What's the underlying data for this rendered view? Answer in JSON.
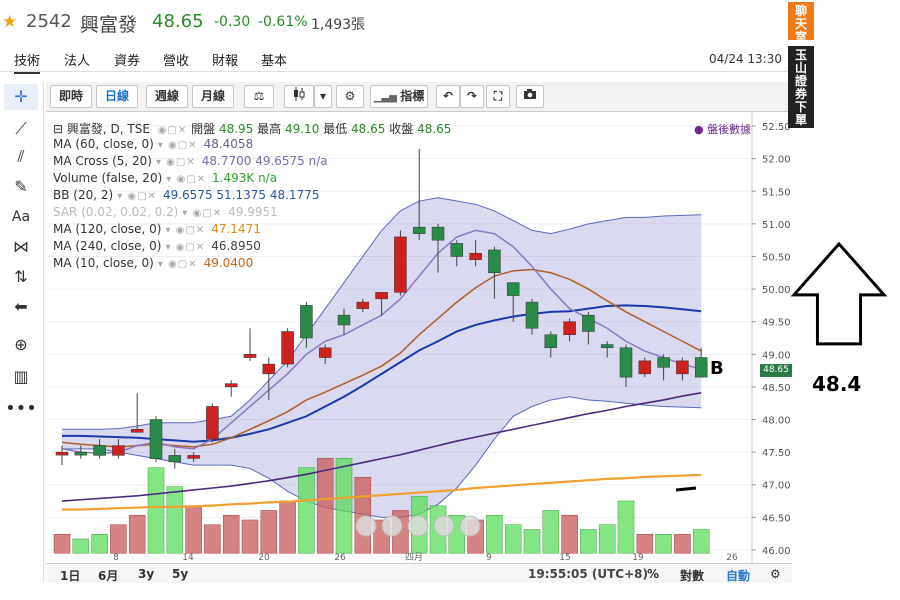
{
  "stock": {
    "code": "2542",
    "name": "興富發",
    "price": "48.65",
    "change": "-0.30",
    "change_pct": "-0.61%",
    "volume": "1,493張"
  },
  "tabs": [
    "技術",
    "法人",
    "資券",
    "營收",
    "財報",
    "基本"
  ],
  "datetime": "04/24 13:30",
  "toolbar": {
    "buttons": [
      "即時",
      "日線",
      "週線",
      "月線",
      "⚖",
      "▾",
      "⚙",
      "指標",
      "↶",
      "↷",
      "⛶",
      "📷"
    ],
    "active": "日線",
    "indicators_label": "指標"
  },
  "legend": {
    "main": {
      "label": "興富發, D, TSE",
      "open_lbl": "開盤",
      "open": "48.95",
      "high_lbl": "最高",
      "high": "49.10",
      "low_lbl": "最低",
      "low": "48.65",
      "close_lbl": "收盤",
      "close": "48.65"
    },
    "after_hours": "● 盤後數據",
    "rows": [
      {
        "label": "MA (60, close, 0)",
        "values": "48.4058",
        "color": "#6b5b9a"
      },
      {
        "label": "MA Cross (5, 20)",
        "values": "48.7700  49.6575  n/a",
        "color": "#7a6bb0"
      },
      {
        "label": "Volume (false, 20)",
        "values": "1.493K  n/a",
        "color": "#2aa52a"
      },
      {
        "label": "BB (20, 2)",
        "values": "49.6575  51.1375  48.1775",
        "color": "#2a55b0"
      },
      {
        "label": "SAR (0.02, 0.02, 0.2)",
        "values": "49.9951",
        "color": "#bbbbbb"
      },
      {
        "label": "MA (120, close, 0)",
        "values": "47.1471",
        "color": "#e08a1a"
      },
      {
        "label": "MA (240, close, 0)",
        "values": "46.8950",
        "color": "#444444"
      },
      {
        "label": "MA (10, close, 0)",
        "values": "49.0400",
        "color": "#c06a1a"
      }
    ]
  },
  "yaxis": [
    "52.50",
    "52.00",
    "51.50",
    "51.00",
    "50.50",
    "50.00",
    "49.50",
    "49.00",
    "48.50",
    "48.00",
    "47.50",
    "47.00",
    "46.50",
    "46.00"
  ],
  "xaxis": [
    "8",
    "14",
    "20",
    "26",
    "四月",
    "9",
    "15",
    "19",
    "26"
  ],
  "price_badge": "48.65",
  "annotation_b": "B",
  "annotation_value": "48.4",
  "bottombar": {
    "ranges": [
      "1日",
      "6月",
      "3y",
      "5y"
    ],
    "time": "19:55:05 (UTC+8)",
    "pct": "%",
    "log": "對數",
    "auto": "自動"
  },
  "sidebar": {
    "chat": "聊天室",
    "broker": "玉山證券下單",
    "chat_color": "#f07a1a",
    "broker_color": "#222222"
  },
  "chart_data": {
    "type": "candlestick",
    "ylim": [
      45.8,
      52.7
    ],
    "candles": [
      {
        "o": 47.5,
        "c": 47.5,
        "h": 47.6,
        "l": 47.3,
        "up": true
      },
      {
        "o": 47.5,
        "c": 47.5,
        "h": 47.6,
        "l": 47.4,
        "up": false
      },
      {
        "o": 47.6,
        "c": 47.45,
        "h": 47.7,
        "l": 47.4,
        "up": false
      },
      {
        "o": 47.6,
        "c": 47.45,
        "h": 47.7,
        "l": 47.4,
        "up": true
      },
      {
        "o": 47.85,
        "c": 47.85,
        "h": 48.4,
        "l": 47.8,
        "up": true
      },
      {
        "o": 48.0,
        "c": 47.4,
        "h": 48.05,
        "l": 47.35,
        "up": false
      },
      {
        "o": 47.45,
        "c": 47.35,
        "h": 47.55,
        "l": 47.25,
        "up": false
      },
      {
        "o": 47.45,
        "c": 47.45,
        "h": 47.5,
        "l": 47.35,
        "up": true
      },
      {
        "o": 47.7,
        "c": 48.2,
        "h": 48.25,
        "l": 47.65,
        "up": true
      },
      {
        "o": 48.5,
        "c": 48.55,
        "h": 48.6,
        "l": 48.35,
        "up": true
      },
      {
        "o": 48.95,
        "c": 49.0,
        "h": 49.4,
        "l": 48.9,
        "up": true
      },
      {
        "o": 48.85,
        "c": 48.7,
        "h": 48.95,
        "l": 48.3,
        "up": true
      },
      {
        "o": 48.85,
        "c": 49.35,
        "h": 49.4,
        "l": 48.8,
        "up": true
      },
      {
        "o": 49.25,
        "c": 49.75,
        "h": 49.8,
        "l": 49.1,
        "up": false
      },
      {
        "o": 49.1,
        "c": 48.95,
        "h": 49.15,
        "l": 48.85,
        "up": true
      },
      {
        "o": 49.45,
        "c": 49.6,
        "h": 49.7,
        "l": 49.3,
        "up": false
      },
      {
        "o": 49.7,
        "c": 49.8,
        "h": 49.85,
        "l": 49.65,
        "up": true
      },
      {
        "o": 49.95,
        "c": 49.85,
        "h": 49.95,
        "l": 49.6,
        "up": true
      },
      {
        "o": 49.95,
        "c": 50.8,
        "h": 50.9,
        "l": 49.9,
        "up": true
      },
      {
        "o": 50.85,
        "c": 50.95,
        "h": 52.15,
        "l": 50.75,
        "up": false
      },
      {
        "o": 50.95,
        "c": 50.75,
        "h": 51.0,
        "l": 50.25,
        "up": false
      },
      {
        "o": 50.7,
        "c": 50.5,
        "h": 50.75,
        "l": 50.35,
        "up": false
      },
      {
        "o": 50.55,
        "c": 50.45,
        "h": 50.75,
        "l": 50.35,
        "up": true
      },
      {
        "o": 50.6,
        "c": 50.25,
        "h": 50.65,
        "l": 49.85,
        "up": false
      },
      {
        "o": 50.1,
        "c": 49.9,
        "h": 50.1,
        "l": 49.5,
        "up": false
      },
      {
        "o": 49.8,
        "c": 49.4,
        "h": 49.85,
        "l": 49.3,
        "up": false
      },
      {
        "o": 49.3,
        "c": 49.1,
        "h": 49.35,
        "l": 48.95,
        "up": false
      },
      {
        "o": 49.5,
        "c": 49.3,
        "h": 49.55,
        "l": 49.2,
        "up": true
      },
      {
        "o": 49.6,
        "c": 49.35,
        "h": 49.65,
        "l": 49.15,
        "up": false
      },
      {
        "o": 49.15,
        "c": 49.1,
        "h": 49.2,
        "l": 48.95,
        "up": false
      },
      {
        "o": 49.1,
        "c": 48.65,
        "h": 49.15,
        "l": 48.5,
        "up": false
      },
      {
        "o": 48.9,
        "c": 48.7,
        "h": 48.95,
        "l": 48.65,
        "up": true
      },
      {
        "o": 48.95,
        "c": 48.8,
        "h": 49.0,
        "l": 48.6,
        "up": false
      },
      {
        "o": 48.9,
        "c": 48.7,
        "h": 48.95,
        "l": 48.6,
        "up": true
      },
      {
        "o": 48.95,
        "c": 48.65,
        "h": 49.1,
        "l": 48.65,
        "up": false
      }
    ],
    "volume_rel": [
      0.2,
      0.15,
      0.2,
      0.3,
      0.4,
      0.9,
      0.7,
      0.5,
      0.3,
      0.4,
      0.35,
      0.45,
      0.55,
      0.9,
      1.0,
      1.0,
      0.8,
      0.35,
      0.45,
      0.6,
      0.5,
      0.4,
      0.35,
      0.4,
      0.3,
      0.25,
      0.45,
      0.4,
      0.25,
      0.3,
      0.55,
      0.2,
      0.2,
      0.2,
      0.25
    ],
    "series": [
      {
        "name": "MA (10, close, 0)",
        "values": [
          47.65,
          47.62,
          47.6,
          47.58,
          47.6,
          47.62,
          47.6,
          47.58,
          47.62,
          47.72,
          47.85,
          47.98,
          48.12,
          48.3,
          48.42,
          48.55,
          48.68,
          48.82,
          49.02,
          49.3,
          49.55,
          49.8,
          50.02,
          50.2,
          50.28,
          50.3,
          50.25,
          50.15,
          50.0,
          49.82,
          49.65,
          49.5,
          49.35,
          49.2,
          49.05
        ]
      },
      {
        "name": "MA Cross (5, 20)",
        "values": [
          47.55,
          47.5,
          47.48,
          47.5,
          47.6,
          47.65,
          47.58,
          47.55,
          47.7,
          47.95,
          48.2,
          48.45,
          48.7,
          49.0,
          49.2,
          49.3,
          49.45,
          49.6,
          49.85,
          50.2,
          50.55,
          50.8,
          50.9,
          50.85,
          50.65,
          50.35,
          50.0,
          49.7,
          49.55,
          49.4,
          49.2,
          49.05,
          48.95,
          48.85,
          48.77
        ]
      },
      {
        "name": "BB (20, 2)",
        "values": [
          47.75,
          47.75,
          47.74,
          47.73,
          47.72,
          47.7,
          47.68,
          47.66,
          47.68,
          47.72,
          47.78,
          47.85,
          47.95,
          48.05,
          48.2,
          48.35,
          48.52,
          48.7,
          48.88,
          49.06,
          49.2,
          49.35,
          49.45,
          49.52,
          49.58,
          49.62,
          49.65,
          49.66,
          49.7,
          49.74,
          49.75,
          49.74,
          49.72,
          49.69,
          49.66
        ]
      },
      {
        "name": "BB upper",
        "values": [
          47.85,
          47.85,
          47.85,
          47.86,
          47.9,
          47.95,
          47.95,
          47.95,
          48.0,
          48.05,
          48.3,
          48.6,
          48.9,
          49.3,
          49.7,
          50.1,
          50.5,
          50.9,
          51.2,
          51.35,
          51.4,
          51.35,
          51.3,
          51.2,
          51.05,
          50.9,
          50.85,
          50.92,
          51.0,
          51.05,
          51.1,
          51.1,
          51.12,
          51.13,
          51.14
        ]
      },
      {
        "name": "BB lower",
        "values": [
          47.55,
          47.55,
          47.55,
          47.5,
          47.45,
          47.4,
          47.35,
          47.3,
          47.3,
          47.3,
          47.25,
          47.1,
          46.9,
          46.75,
          46.65,
          46.6,
          46.55,
          46.5,
          46.5,
          46.55,
          46.7,
          46.95,
          47.3,
          47.7,
          48.05,
          48.2,
          48.3,
          48.35,
          48.3,
          48.28,
          48.25,
          48.22,
          48.2,
          48.19,
          48.18
        ]
      },
      {
        "name": "MA (60, close, 0)",
        "values": [
          46.75,
          46.77,
          46.79,
          46.81,
          46.83,
          46.86,
          46.89,
          46.92,
          46.95,
          46.98,
          47.02,
          47.06,
          47.11,
          47.16,
          47.22,
          47.28,
          47.34,
          47.4,
          47.46,
          47.53,
          47.6,
          47.67,
          47.73,
          47.79,
          47.85,
          47.91,
          47.97,
          48.03,
          48.09,
          48.14,
          48.2,
          48.25,
          48.3,
          48.36,
          48.41
        ]
      },
      {
        "name": "MA (120, close, 0)",
        "values": [
          46.62,
          46.62,
          46.63,
          46.64,
          46.65,
          46.66,
          46.66,
          46.67,
          46.68,
          46.7,
          46.71,
          46.73,
          46.74,
          46.76,
          46.78,
          46.8,
          46.82,
          46.84,
          46.86,
          46.88,
          46.9,
          46.92,
          46.95,
          46.97,
          46.99,
          47.01,
          47.03,
          47.05,
          47.07,
          47.09,
          47.1,
          47.12,
          47.13,
          47.14,
          47.15
        ]
      }
    ]
  }
}
